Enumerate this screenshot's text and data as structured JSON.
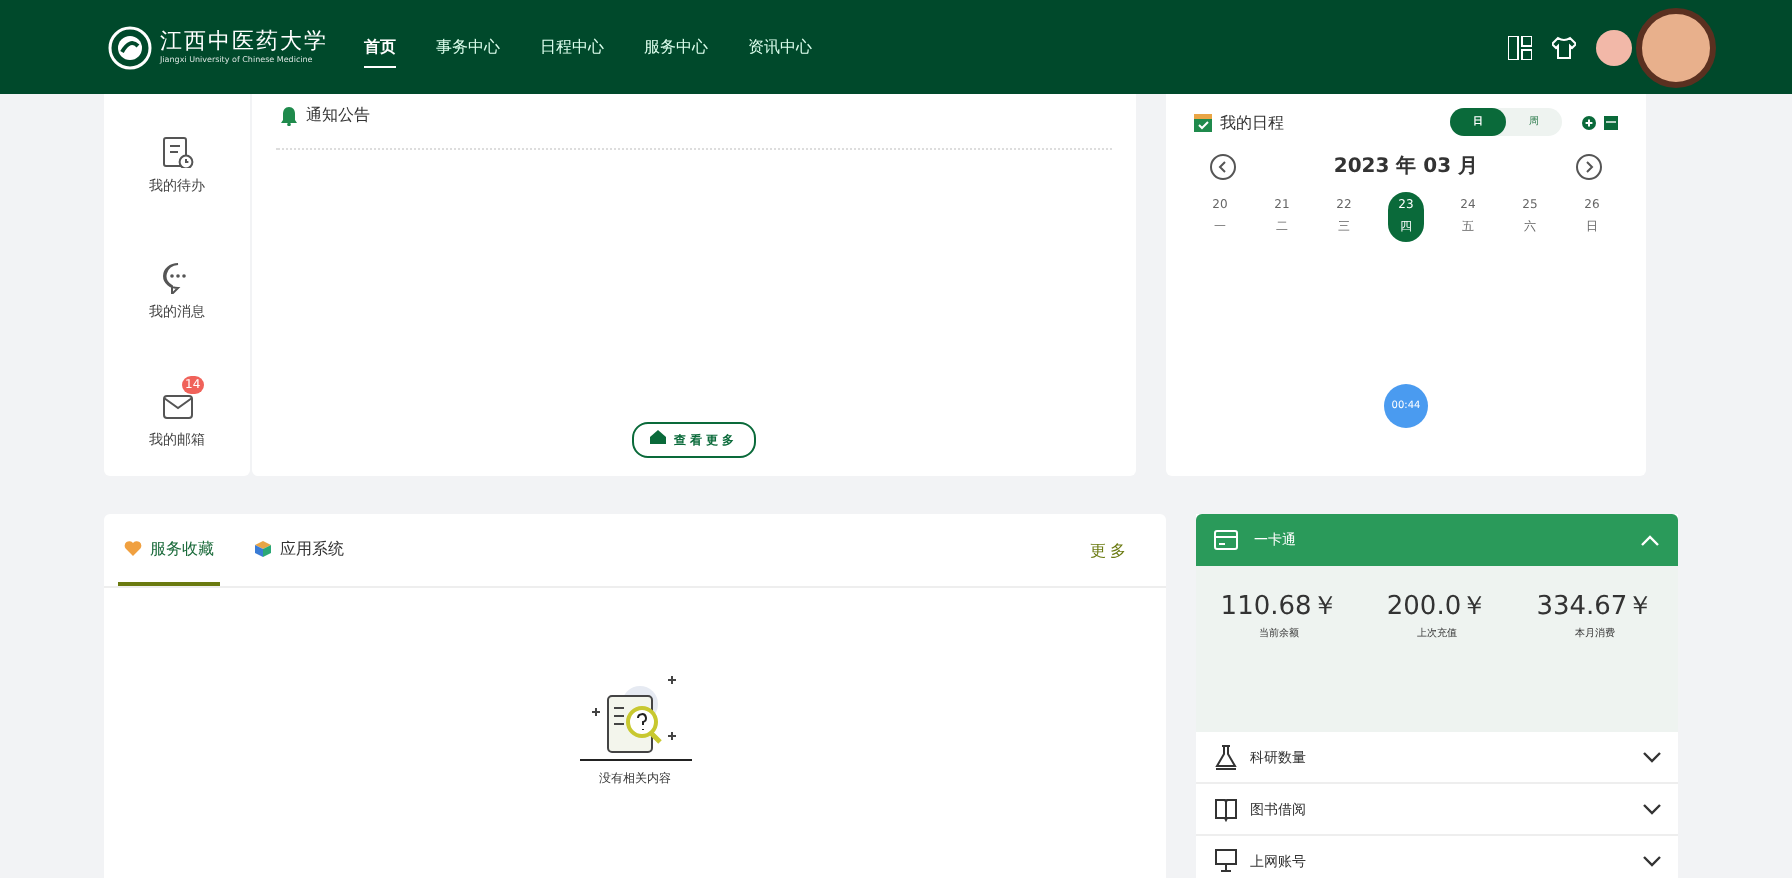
{
  "header": {
    "logo_title": "江西中医药大学",
    "logo_subtitle": "Jiangxi University of Chinese Medicine",
    "nav": [
      {
        "label": "首页",
        "selected": true
      },
      {
        "label": "事务中心",
        "selected": false
      },
      {
        "label": "日程中心",
        "selected": false
      },
      {
        "label": "服务中心",
        "selected": false
      },
      {
        "label": "资讯中心",
        "selected": false
      }
    ]
  },
  "quick_links": [
    {
      "kind": "todo",
      "label": "我的待办"
    },
    {
      "kind": "message",
      "label": "我的消息"
    },
    {
      "kind": "mail",
      "label": "我的邮箱",
      "badge": "14"
    }
  ],
  "notices": {
    "title": "通知公告",
    "more_button": "查看更多"
  },
  "schedule": {
    "title": "我的日程",
    "views": [
      {
        "label": "日",
        "selected": true
      },
      {
        "label": "周",
        "selected": false
      }
    ],
    "month": "2023 年 03 月",
    "days": [
      {
        "date": "20",
        "weekday": "一",
        "selected": false
      },
      {
        "date": "21",
        "weekday": "二",
        "selected": false
      },
      {
        "date": "22",
        "weekday": "三",
        "selected": false
      },
      {
        "date": "23",
        "weekday": "四",
        "selected": true
      },
      {
        "date": "24",
        "weekday": "五",
        "selected": false
      },
      {
        "date": "25",
        "weekday": "六",
        "selected": false
      },
      {
        "date": "26",
        "weekday": "日",
        "selected": false
      }
    ],
    "time_bubble": "00:44"
  },
  "services": {
    "tabs": [
      {
        "label": "服务收藏",
        "selected": true
      },
      {
        "label": "应用系统",
        "selected": false
      }
    ],
    "more": "更多",
    "empty_text": "没有相关内容"
  },
  "card": {
    "title": "一卡通",
    "stats": [
      {
        "value": "110.68￥",
        "label": "当前余额"
      },
      {
        "value": "200.0￥",
        "label": "上次充值"
      },
      {
        "value": "334.67￥",
        "label": "本月消费"
      }
    ],
    "rows": [
      {
        "kind": "flask",
        "label": "科研数量"
      },
      {
        "kind": "book",
        "label": "图书借阅"
      },
      {
        "kind": "monitor",
        "label": "上网账号"
      }
    ]
  }
}
